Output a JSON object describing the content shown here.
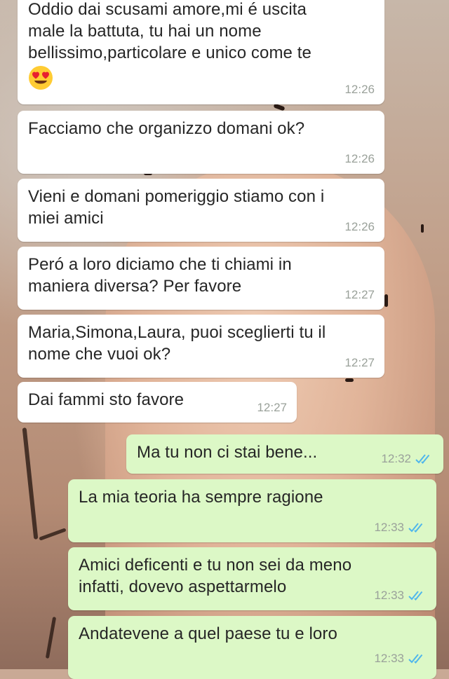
{
  "chat": {
    "messages": [
      {
        "id": "m1",
        "direction": "in",
        "text": "Oddio dai scusami amore,mi é uscita\nmale la battuta, tu hai un nome\nbellissimo,particolare e unico come te",
        "emoji": "heart-eyes",
        "time": "12:26"
      },
      {
        "id": "m2",
        "direction": "in",
        "text": "Facciamo che organizzo domani ok?",
        "time": "12:26"
      },
      {
        "id": "m3",
        "direction": "in",
        "text": "Vieni e domani pomeriggio stiamo con i\nmiei amici",
        "time": "12:26"
      },
      {
        "id": "m4",
        "direction": "in",
        "text": "Peró a loro diciamo che ti chiami in\nmaniera diversa? Per favore",
        "time": "12:27"
      },
      {
        "id": "m5",
        "direction": "in",
        "text": "Maria,Simona,Laura, puoi sceglierti tu il\nnome che vuoi ok?",
        "time": "12:27"
      },
      {
        "id": "m6",
        "direction": "in",
        "text": "Dai fammi sto favore",
        "time": "12:27"
      },
      {
        "id": "m7",
        "direction": "out",
        "text": "Ma tu non ci stai bene...",
        "time": "12:32",
        "status": "read"
      },
      {
        "id": "m8",
        "direction": "out",
        "text": "La mia teoria ha sempre ragione",
        "time": "12:33",
        "status": "read"
      },
      {
        "id": "m9",
        "direction": "out",
        "text": "Amici deficenti e tu non sei da meno\ninfatti, dovevo aspettarmelo",
        "time": "12:33",
        "status": "read"
      },
      {
        "id": "m10",
        "direction": "out",
        "text": "Andatevene a quel paese tu e loro",
        "time": "12:33",
        "status": "read"
      }
    ]
  },
  "colors": {
    "incoming_bubble": "#ffffff",
    "outgoing_bubble": "#dcf8c6",
    "read_tick": "#4fb6ec",
    "timestamp": "#9aa19a"
  }
}
